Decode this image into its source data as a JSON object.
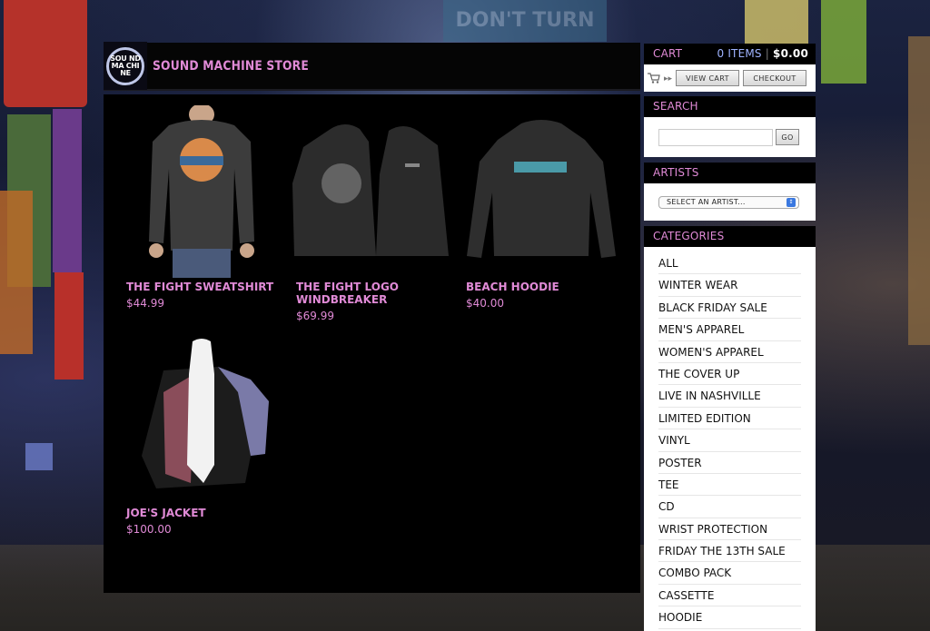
{
  "store": {
    "title": "SOUND MACHINE STORE",
    "logo_text": "SOU ND MA CHI NE"
  },
  "background_sign": "DON'T TURN",
  "products": [
    {
      "name": "THE FIGHT SWEATSHIRT",
      "price": "$44.99"
    },
    {
      "name": "THE FIGHT LOGO WINDBREAKER",
      "price": "$69.99"
    },
    {
      "name": "BEACH HOODIE",
      "price": "$40.00"
    },
    {
      "name": "JOE'S JACKET",
      "price": "$100.00"
    }
  ],
  "cart": {
    "title": "CART",
    "items": "0 ITEMS",
    "total": "$0.00",
    "view_cart": "VIEW CART",
    "checkout": "CHECKOUT"
  },
  "search": {
    "title": "SEARCH",
    "go": "GO",
    "value": ""
  },
  "artists": {
    "title": "ARTISTS",
    "selected": "SELECT AN ARTIST..."
  },
  "categories": {
    "title": "CATEGORIES",
    "items": [
      "ALL",
      "WINTER WEAR",
      "BLACK FRIDAY SALE",
      "MEN'S APPAREL",
      "WOMEN'S APPAREL",
      "THE COVER UP",
      "LIVE IN NASHVILLE",
      "LIMITED EDITION",
      "VINYL",
      "POSTER",
      "TEE",
      "CD",
      "WRIST PROTECTION",
      "FRIDAY THE 13TH SALE",
      "COMBO PACK",
      "CASSETTE",
      "HOODIE"
    ]
  },
  "colors": {
    "accent": "#e08ad6",
    "panel_head": "#000000",
    "main_bg": "#000000"
  }
}
